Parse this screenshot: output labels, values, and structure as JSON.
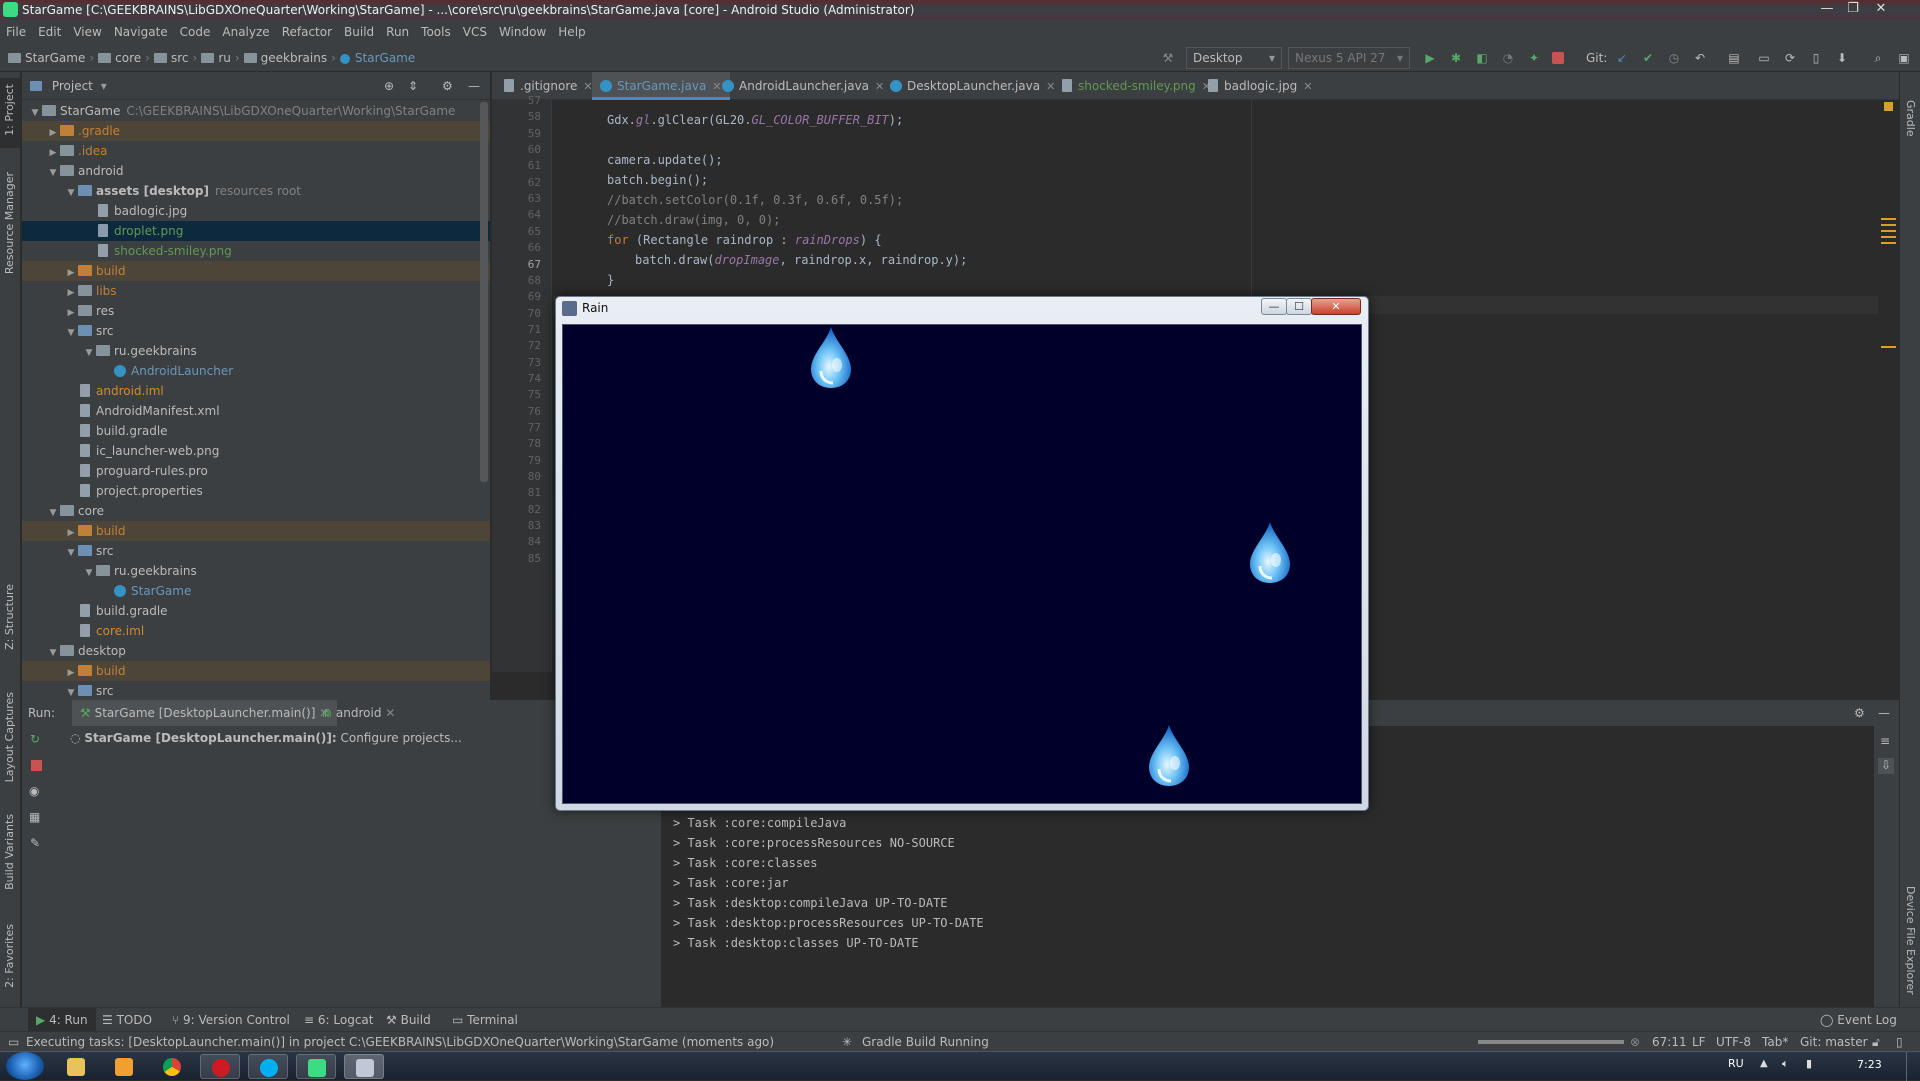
{
  "window": {
    "title": "StarGame [C:\\GEEKBRAINS\\LibGDXOneQuarter\\Working\\StarGame] - ...\\core\\src\\ru\\geekbrains\\StarGame.java [core] - Android Studio (Administrator)"
  },
  "menu": [
    "File",
    "Edit",
    "View",
    "Navigate",
    "Code",
    "Analyze",
    "Refactor",
    "Build",
    "Run",
    "Tools",
    "VCS",
    "Window",
    "Help"
  ],
  "breadcrumb": [
    "StarGame",
    "core",
    "src",
    "ru",
    "geekbrains",
    "StarGame"
  ],
  "toolbar": {
    "run_config": "Desktop",
    "device": "Nexus 5 API 27",
    "git_label": "Git:"
  },
  "left_strip": {
    "project": "1: Project",
    "resource_manager": "Resource Manager",
    "structure": "Z: Structure",
    "layout_captures": "Layout Captures",
    "build_variants": "Build Variants",
    "favorites": "2: Favorites"
  },
  "right_strip": {
    "gradle": "Gradle",
    "device_file_explorer": "Device File Explorer"
  },
  "project_panel": {
    "header": "Project",
    "rows": [
      {
        "label": "StarGame",
        "extra": "C:\\GEEKBRAINS\\LibGDXOneQuarter\\Working\\StarGame"
      },
      {
        "label": ".gradle"
      },
      {
        "label": ".idea"
      },
      {
        "label": "android"
      },
      {
        "label": "assets [desktop]",
        "extra": "resources root"
      },
      {
        "label": "badlogic.jpg"
      },
      {
        "label": "droplet.png"
      },
      {
        "label": "shocked-smiley.png"
      },
      {
        "label": "build"
      },
      {
        "label": "libs"
      },
      {
        "label": "res"
      },
      {
        "label": "src"
      },
      {
        "label": "ru.geekbrains"
      },
      {
        "label": "AndroidLauncher"
      },
      {
        "label": "android.iml"
      },
      {
        "label": "AndroidManifest.xml"
      },
      {
        "label": "build.gradle"
      },
      {
        "label": "ic_launcher-web.png"
      },
      {
        "label": "proguard-rules.pro"
      },
      {
        "label": "project.properties"
      },
      {
        "label": "core"
      },
      {
        "label": "build"
      },
      {
        "label": "src"
      },
      {
        "label": "ru.geekbrains"
      },
      {
        "label": "StarGame"
      },
      {
        "label": "build.gradle"
      },
      {
        "label": "core.iml"
      },
      {
        "label": "desktop"
      },
      {
        "label": "build"
      },
      {
        "label": "src"
      }
    ]
  },
  "tabs": [
    ".gitignore",
    "StarGame.java",
    "AndroidLauncher.java",
    "DesktopLauncher.java",
    "shocked-smiley.png",
    "badlogic.jpg"
  ],
  "editor": {
    "line_numbers": [
      "57",
      "58",
      "59",
      "60",
      "61",
      "62",
      "63",
      "64",
      "65",
      "66",
      "67",
      "68",
      "69",
      "70",
      "71",
      "72",
      "73",
      "74",
      "75",
      "76",
      "77",
      "78",
      "79",
      "80",
      "81",
      "82",
      "83",
      "84",
      "85"
    ],
    "line1_a": "Gdx.",
    "line1_b": "gl",
    "line1_c": ".glClear(GL20.",
    "line1_d": "GL_COLOR_BUFFER_BIT",
    "line1_e": ");",
    "line2": "camera.update();",
    "line3": "batch.begin();",
    "line4": "//batch.setColor(0.1f, 0.3f, 0.6f, 0.5f);",
    "line5": "//batch.draw(img, 0, 0);",
    "line6_kw": "for",
    "line6_a": " (Rectangle raindrop : ",
    "line6_b": "rainDrops",
    "line6_c": ") {",
    "line7_a": "batch.draw(",
    "line7_b": "dropImage",
    "line7_c": ", raindrop.x, raindrop.y);",
    "line8": "}"
  },
  "run_panel": {
    "label": "Run:",
    "tab1": "StarGame [DesktopLauncher.main()]",
    "tab2": "android",
    "task_status": "StarGame [DesktopLauncher.main()]:",
    "task_detail": "Configure projects...",
    "console": [
      "> Task :core:compileJava",
      "> Task :core:processResources NO-SOURCE",
      "> Task :core:classes",
      "> Task :core:jar",
      "> Task :desktop:compileJava UP-TO-DATE",
      "> Task :desktop:processResources UP-TO-DATE",
      "> Task :desktop:classes UP-TO-DATE"
    ]
  },
  "bottom_tabs": [
    "4: Run",
    "TODO",
    "9: Version Control",
    "6: Logcat",
    "Build",
    "Terminal"
  ],
  "event_log": "Event Log",
  "status": {
    "message": "Executing tasks: [DesktopLauncher.main()] in project C:\\GEEKBRAINS\\LibGDXOneQuarter\\Working\\StarGame (moments ago)",
    "gradle": "Gradle Build Running",
    "position": "67:11",
    "line_sep": "LF",
    "encoding": "UTF-8",
    "indent": "Tab*",
    "git": "Git: master"
  },
  "rain_window": {
    "title": "Rain",
    "minimize": "—",
    "maximize": "☐",
    "close": "✕"
  },
  "taskbar": {
    "lang": "RU",
    "time": "7:23"
  }
}
